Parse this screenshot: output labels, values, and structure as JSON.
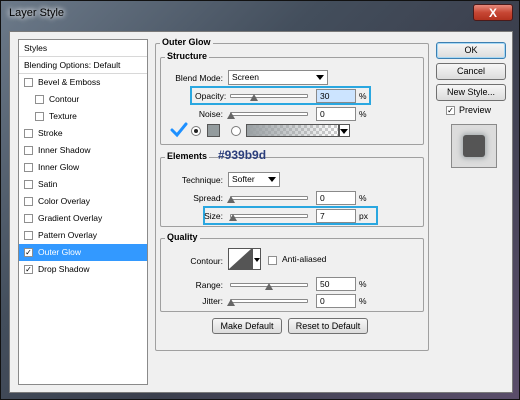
{
  "window": {
    "title": "Layer Style",
    "close_label": "X"
  },
  "left_list": {
    "header": "Styles",
    "blending": "Blending Options: Default",
    "items": [
      {
        "label": "Bevel & Emboss",
        "checked": false
      },
      {
        "label": "Contour",
        "checked": false
      },
      {
        "label": "Texture",
        "checked": false
      },
      {
        "label": "Stroke",
        "checked": false
      },
      {
        "label": "Inner Shadow",
        "checked": false
      },
      {
        "label": "Inner Glow",
        "checked": false
      },
      {
        "label": "Satin",
        "checked": false
      },
      {
        "label": "Color Overlay",
        "checked": false
      },
      {
        "label": "Gradient Overlay",
        "checked": false
      },
      {
        "label": "Pattern Overlay",
        "checked": false
      },
      {
        "label": "Outer Glow",
        "checked": true
      },
      {
        "label": "Drop Shadow",
        "checked": true
      }
    ],
    "check_mark": "✓"
  },
  "outer_glow": {
    "title": "Outer Glow",
    "structure": {
      "title": "Structure",
      "blend_mode_label": "Blend Mode:",
      "blend_mode_value": "Screen",
      "opacity_label": "Opacity:",
      "opacity_value": "30",
      "opacity_unit": "%",
      "opacity_level": 0.3,
      "noise_label": "Noise:",
      "noise_value": "0",
      "noise_unit": "%",
      "noise_level": 0
    },
    "color_annotation": "#939b9d",
    "elements": {
      "title": "Elements",
      "technique_label": "Technique:",
      "technique_value": "Softer",
      "spread_label": "Spread:",
      "spread_value": "0",
      "spread_unit": "%",
      "spread_level": 0,
      "size_label": "Size:",
      "size_value": "7",
      "size_unit": "px",
      "size_level": 0.03
    },
    "quality": {
      "title": "Quality",
      "contour_label": "Contour:",
      "anti_aliased_label": "Anti-aliased",
      "range_label": "Range:",
      "range_value": "50",
      "range_unit": "%",
      "range_level": 0.5,
      "jitter_label": "Jitter:",
      "jitter_value": "0",
      "jitter_unit": "%",
      "jitter_level": 0
    },
    "make_default": "Make Default",
    "reset_default": "Reset to Default"
  },
  "right_buttons": {
    "ok": "OK",
    "cancel": "Cancel",
    "new_style": "New Style...",
    "preview_label": "Preview"
  },
  "colors": {
    "accent_highlight": "#2aa7e0",
    "selection": "#3399ff",
    "checkmark": "#1e90ff",
    "glow_color": "#939b9d"
  }
}
